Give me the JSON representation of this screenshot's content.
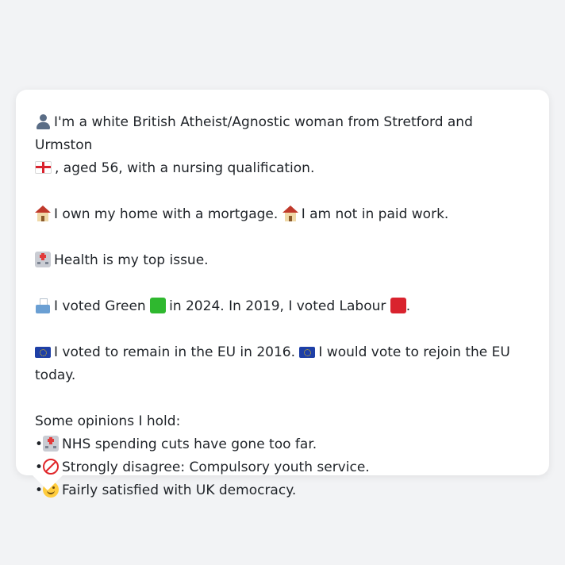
{
  "profile": {
    "line1_text": "I'm a white British Atheist/Agnostic woman from Stretford and Urmston",
    "line1b_text": ", aged 56, with a nursing qualification.",
    "home_text_a": "I own my home with a mortgage.",
    "home_text_b": "I am not in paid work.",
    "issue_text": "Health is my top issue.",
    "vote_a": "I voted Green",
    "vote_b": "in 2024. In 2019, I voted Labour",
    "vote_c": ".",
    "eu_a": "I voted to remain in the EU in 2016.",
    "eu_b": "I would vote to rejoin the EU today."
  },
  "opinions": {
    "heading": "Some opinions I hold:",
    "items": [
      {
        "bullet": "•",
        "icon": "hospital-icon",
        "text": "NHS spending cuts have gone too far."
      },
      {
        "bullet": "•",
        "icon": "no-entry-icon",
        "text": "Strongly disagree: Compulsory youth service."
      },
      {
        "bullet": "•",
        "icon": "smile-icon",
        "text": "Fairly satisfied with UK democracy."
      }
    ]
  },
  "colors": {
    "background": "#f2f3f5",
    "card": "#ffffff",
    "text": "#1f2328",
    "green": "#2fb82f",
    "red": "#d9232e"
  }
}
